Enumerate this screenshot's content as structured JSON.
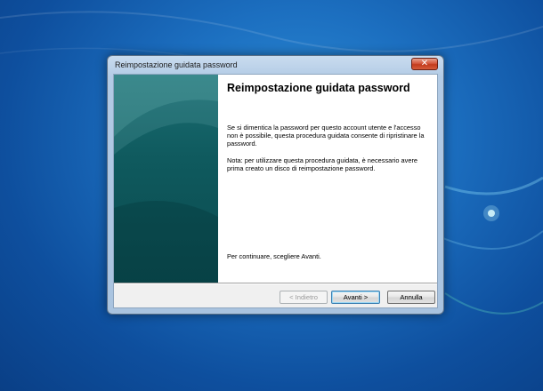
{
  "window": {
    "title": "Reimpostazione guidata password",
    "close_icon": "close-icon"
  },
  "wizard": {
    "heading": "Reimpostazione guidata password",
    "paragraph1": "Se si dimentica la password per questo account utente e l'accesso non è possibile, questa procedura guidata consente di ripristinare la password.",
    "paragraph2": "Nota: per utilizzare questa procedura guidata, è necessario avere prima creato un disco di reimpostazione password.",
    "paragraph3": "Per continuare, scegliere Avanti."
  },
  "buttons": {
    "back": "< Indietro",
    "next": "Avanti >",
    "cancel": "Annulla"
  },
  "colors": {
    "desktop_blue": "#1c6fc0",
    "wizard_side": "#0f5a5e",
    "close_red": "#c23a1c"
  }
}
